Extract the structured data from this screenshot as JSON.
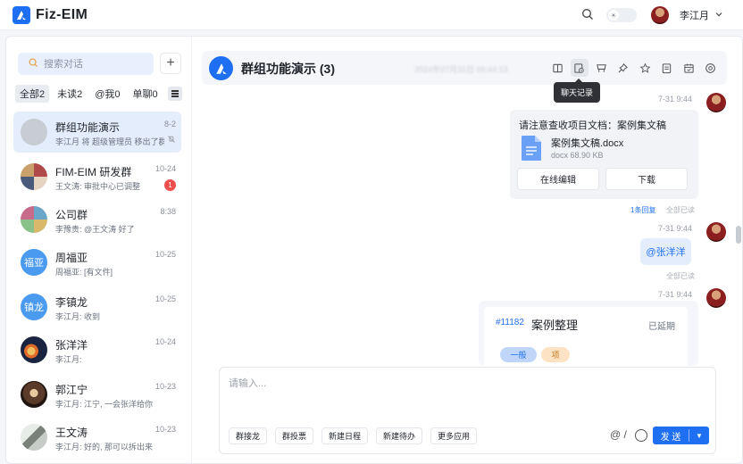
{
  "app": {
    "name": "Fiz-EIM",
    "user_name": "李江月"
  },
  "search": {
    "placeholder": "搜索对话"
  },
  "filters": [
    {
      "label": "全部2",
      "active": true
    },
    {
      "label": "未读2",
      "active": false
    },
    {
      "label": "@我0",
      "active": false
    },
    {
      "label": "单聊0",
      "active": false
    }
  ],
  "conversations": [
    {
      "name": "群组功能演示",
      "time": "8-2",
      "preview": "李江月 将 超级管理员 移出了群聊",
      "avatar_text": "",
      "avatar_color": "#c8ccd3",
      "selected": true,
      "muted": true
    },
    {
      "name": "FIM-EIM 研发群",
      "time": "10-24",
      "preview": "王文涛: 审批中心已调整",
      "avatar_text": "",
      "avatar_color": "#8a6a6a",
      "badge": "1"
    },
    {
      "name": "公司群",
      "time": "8:38",
      "preview": "李豫贵: @王文涛 好了",
      "avatar_text": "",
      "avatar_color": "#6aa6c8"
    },
    {
      "name": "周福亚",
      "time": "10-25",
      "preview": "周福亚: [有文件]",
      "avatar_text": "福亚",
      "avatar_color": "#4a9af0"
    },
    {
      "name": "李镇龙",
      "time": "10-25",
      "preview": "李江月: 收到",
      "avatar_text": "镇龙",
      "avatar_color": "#4a9af0"
    },
    {
      "name": "张洋洋",
      "time": "10-24",
      "preview": "李江月:",
      "avatar_text": "",
      "avatar_color": "#2a3a5a"
    },
    {
      "name": "郭江宁",
      "time": "10-23",
      "preview": "李江月: 江宁, 一会张洋给你",
      "avatar_text": "",
      "avatar_color": "#5a4a3a"
    },
    {
      "name": "王文涛",
      "time": "10-23",
      "preview": "李江月: 好的, 那可以拆出来",
      "avatar_text": "",
      "avatar_color": "#9aa09a"
    }
  ],
  "chat": {
    "title": "群组功能演示 (3)",
    "blurred_text": "2024年07月31日 09:44:13",
    "tooltip": "聊天记录",
    "header_icons": [
      "book-icon",
      "chat-history-icon",
      "cart-icon",
      "pin-icon",
      "star-icon",
      "notes-icon",
      "calendar-icon",
      "settings-icon"
    ]
  },
  "messages": {
    "file": {
      "time": "7-31 9:44",
      "title": "请注意查收项目文档：案例集文稿",
      "filename": "案例集文稿.docx",
      "size": "docx 68.90 KB",
      "edit_label": "在线编辑",
      "download_label": "下载",
      "reply_label": "1条回复",
      "read_label": "全部已读"
    },
    "mention": {
      "time": "7-31 9:44",
      "text": "@张洋洋",
      "read_label": "全部已读"
    },
    "task": {
      "time": "7-31 9:44",
      "id": "#11182",
      "title": "案例整理",
      "status": "已延期",
      "tags": [
        "一般",
        "项"
      ]
    }
  },
  "composer": {
    "placeholder": "请输入...",
    "buttons": [
      "群接龙",
      "群投票",
      "新建日程",
      "新建待办",
      "更多应用"
    ],
    "at_label": "@ /",
    "send_label": "发 送"
  }
}
